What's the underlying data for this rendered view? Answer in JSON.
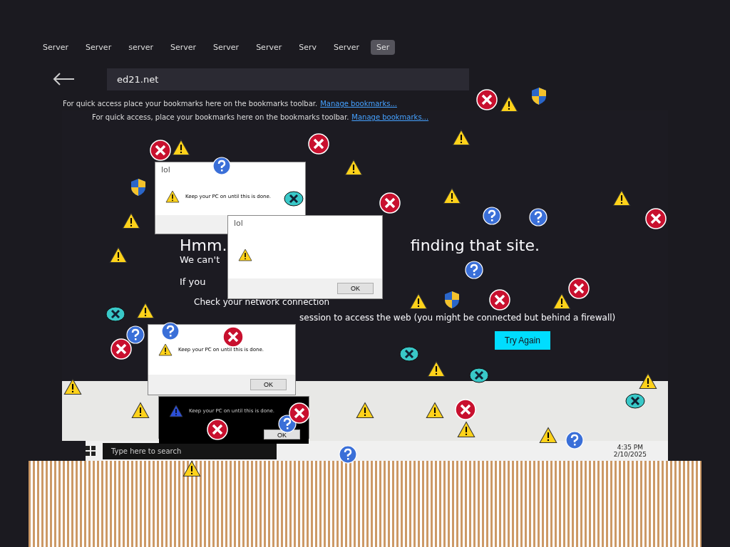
{
  "tabs": [
    {
      "label": "Server",
      "selected": false
    },
    {
      "label": "Server",
      "selected": false
    },
    {
      "label": "server",
      "selected": false
    },
    {
      "label": "Server",
      "selected": false
    },
    {
      "label": "Server",
      "selected": false
    },
    {
      "label": "Server",
      "selected": false
    },
    {
      "label": "Serv",
      "selected": false
    },
    {
      "label": "Server",
      "selected": false
    },
    {
      "label": "Ser",
      "selected": true
    }
  ],
  "toolbar": {
    "url": "ed21.net"
  },
  "bookmark_bars": [
    {
      "text": "For quick access place your bookmarks here on the bookmarks toolbar.",
      "link": "Manage bookmarks..."
    },
    {
      "text": "For quick access, place your bookmarks here on the bookmarks toolbar.",
      "link": "Manage bookmarks..."
    }
  ],
  "error_page": {
    "heading_start": "Hmm.",
    "heading_end": "finding that site.",
    "lines": [
      "We can't",
      "If you"
    ],
    "bullets": [
      "Check your network connection",
      "session to access the web (you might be connected but behind a firewall)"
    ],
    "button": "Try Again"
  },
  "dialogs": [
    {
      "kind": "light",
      "title": "lol",
      "message": "Keep your PC on until this is done."
    },
    {
      "kind": "light",
      "title": "lol",
      "button": "OK"
    },
    {
      "kind": "light",
      "message": "Keep your PC on until this is done.",
      "button": "OK"
    },
    {
      "kind": "dark",
      "message": "Keep your PC on until this is done.",
      "button": "OK"
    }
  ],
  "taskbar": {
    "search_placeholder": "Type here to search",
    "time": "4:35 PM",
    "date": "2/10/2025"
  }
}
